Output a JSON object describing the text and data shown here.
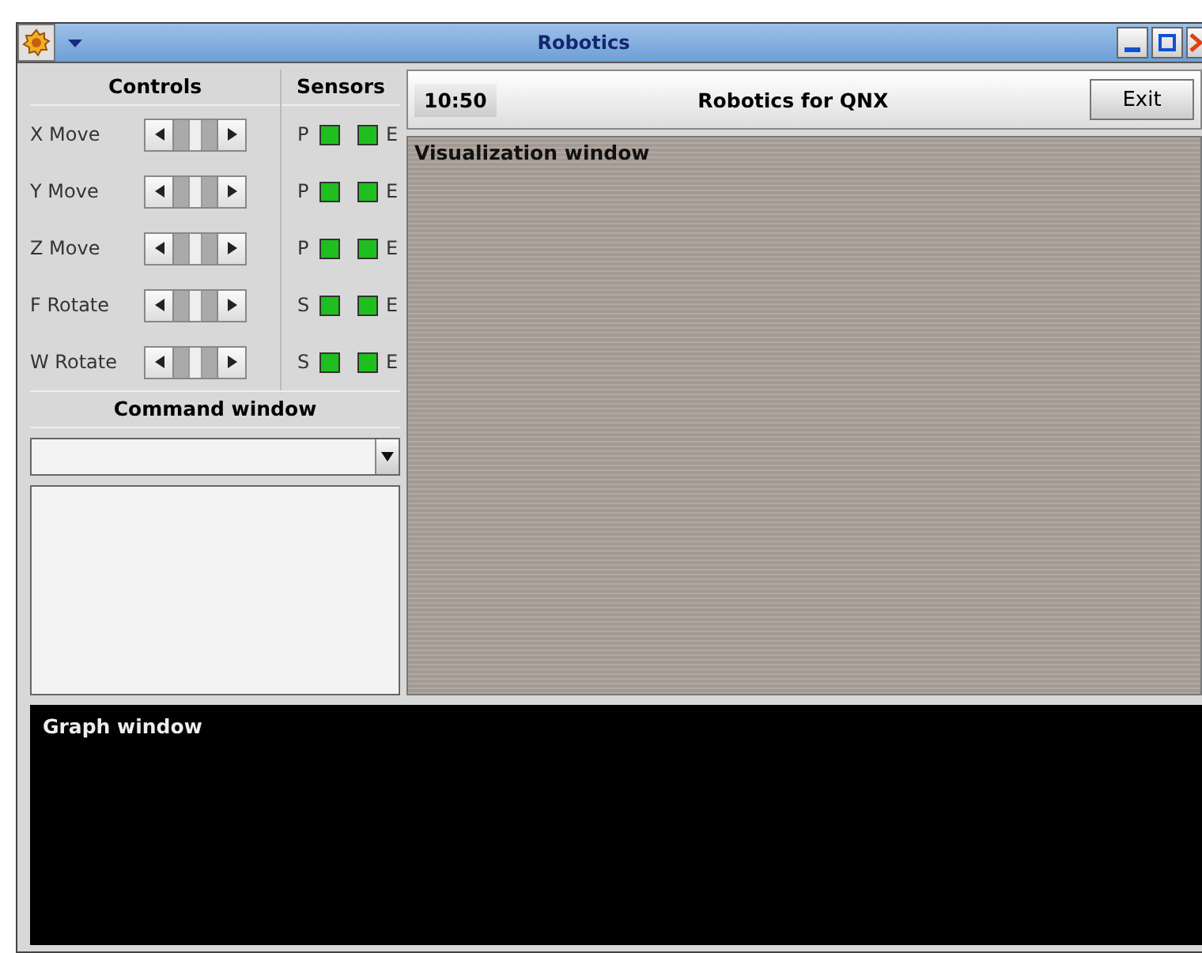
{
  "window": {
    "title": "Robotics"
  },
  "controls": {
    "heading": "Controls",
    "items": [
      {
        "label": "X Move",
        "level": 0.5
      },
      {
        "label": "Y Move",
        "level": 0.5
      },
      {
        "label": "Z Move",
        "level": 0.5
      },
      {
        "label": "F Rotate",
        "level": 0.5
      },
      {
        "label": "W Rotate",
        "level": 0.5
      }
    ]
  },
  "sensors": {
    "heading": "Sensors",
    "rows": [
      {
        "left": "P",
        "right": "E",
        "left_on": true,
        "right_on": true
      },
      {
        "left": "P",
        "right": "E",
        "left_on": true,
        "right_on": true
      },
      {
        "left": "P",
        "right": "E",
        "left_on": true,
        "right_on": true
      },
      {
        "left": "S",
        "right": "E",
        "left_on": true,
        "right_on": true
      },
      {
        "left": "S",
        "right": "E",
        "left_on": true,
        "right_on": true
      }
    ]
  },
  "command_window": {
    "heading": "Command window"
  },
  "header": {
    "clock": "10:50",
    "title": "Robotics for QNX",
    "exit_button": "Exit"
  },
  "visualization": {
    "label": "Visualization window"
  },
  "graph": {
    "label": "Graph window"
  }
}
